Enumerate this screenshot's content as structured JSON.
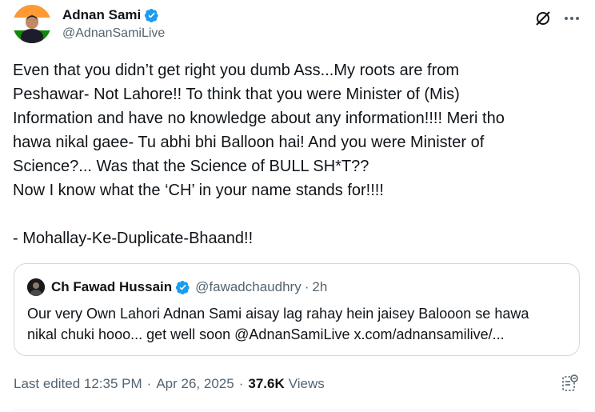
{
  "author": {
    "display_name": "Adnan Sami",
    "handle": "@AdnanSamiLive"
  },
  "tweet": {
    "lines": [
      "Even that you didn’t get right you dumb Ass...My roots are from",
      "Peshawar- Not Lahore!! To think that you were Minister of (Mis)",
      "Information and have no knowledge about any information!!!! Meri tho",
      "hawa nikal gaee- Tu abhi bhi Balloon hai! And you were Minister of",
      "Science?... Was that the Science of BULL SH*T??",
      "Now I know what the ‘CH’ in your name stands for!!!!",
      "",
      "- Mohallay-Ke-Duplicate-Bhaand!!"
    ]
  },
  "quote": {
    "display_name": "Ch Fawad Hussain",
    "handle": "@fawadchaudhry",
    "dot": "·",
    "time": "2h",
    "lines": [
      "Our very Own Lahori Adnan Sami aisay lag rahay hein jaisey Balooon se hawa",
      "nikal chuki hooo... get well soon @AdnanSamiLive x.com/adnansamilive/..."
    ]
  },
  "meta": {
    "edited_label": "Last edited 12:35 PM",
    "sep": "·",
    "date": "Apr 26, 2025",
    "views_count": "37.6K",
    "views_label": "Views"
  },
  "colors": {
    "verified": "#1d9bf0",
    "text_primary": "#0f1419",
    "text_secondary": "#536471",
    "border": "#cfd9de"
  },
  "icons": {
    "header": [
      "grok-icon",
      "more-icon"
    ],
    "meta": "edit-history-icon"
  }
}
